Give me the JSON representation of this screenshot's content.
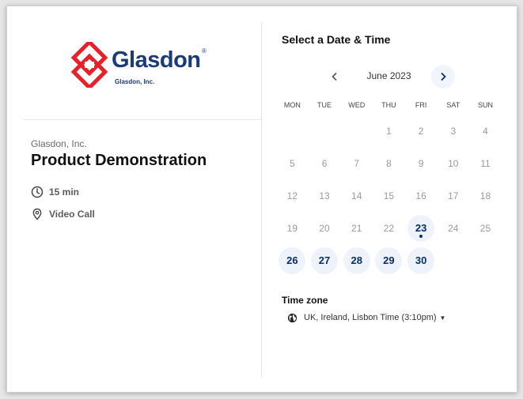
{
  "brand": {
    "name": "Glasdon",
    "registered_mark": "®",
    "sub": "Glasdon, Inc.",
    "colors": {
      "mark": "#e8202a",
      "text": "#1b3a78"
    }
  },
  "event": {
    "organizer": "Glasdon, Inc.",
    "title": "Product Demonstration",
    "duration": "15 min",
    "location": "Video Call",
    "duration_icon": "clock-icon",
    "location_icon": "location-pin-icon"
  },
  "scheduler": {
    "title": "Select a Date & Time",
    "month": "June 2023",
    "prev_icon": "chevron-left-icon",
    "next_icon": "chevron-right-icon",
    "weekdays": [
      "MON",
      "TUE",
      "WED",
      "THU",
      "FRI",
      "SAT",
      "SUN"
    ],
    "days": [
      null,
      null,
      null,
      {
        "n": "1",
        "avail": false
      },
      {
        "n": "2",
        "avail": false
      },
      {
        "n": "3",
        "avail": false
      },
      {
        "n": "4",
        "avail": false
      },
      {
        "n": "5",
        "avail": false
      },
      {
        "n": "6",
        "avail": false
      },
      {
        "n": "7",
        "avail": false
      },
      {
        "n": "8",
        "avail": false
      },
      {
        "n": "9",
        "avail": false
      },
      {
        "n": "10",
        "avail": false
      },
      {
        "n": "11",
        "avail": false
      },
      {
        "n": "12",
        "avail": false
      },
      {
        "n": "13",
        "avail": false
      },
      {
        "n": "14",
        "avail": false
      },
      {
        "n": "15",
        "avail": false
      },
      {
        "n": "16",
        "avail": false
      },
      {
        "n": "17",
        "avail": false
      },
      {
        "n": "18",
        "avail": false
      },
      {
        "n": "19",
        "avail": false
      },
      {
        "n": "20",
        "avail": false
      },
      {
        "n": "21",
        "avail": false
      },
      {
        "n": "22",
        "avail": false
      },
      {
        "n": "23",
        "avail": true,
        "today": true
      },
      {
        "n": "24",
        "avail": false
      },
      {
        "n": "25",
        "avail": false
      },
      {
        "n": "26",
        "avail": true
      },
      {
        "n": "27",
        "avail": true
      },
      {
        "n": "28",
        "avail": true
      },
      {
        "n": "29",
        "avail": true
      },
      {
        "n": "30",
        "avail": true
      }
    ],
    "timezone_label": "Time zone",
    "timezone_value": "UK, Ireland, Lisbon Time (3:10pm)",
    "timezone_icon": "globe-icon",
    "accent": "#0a2f63"
  }
}
